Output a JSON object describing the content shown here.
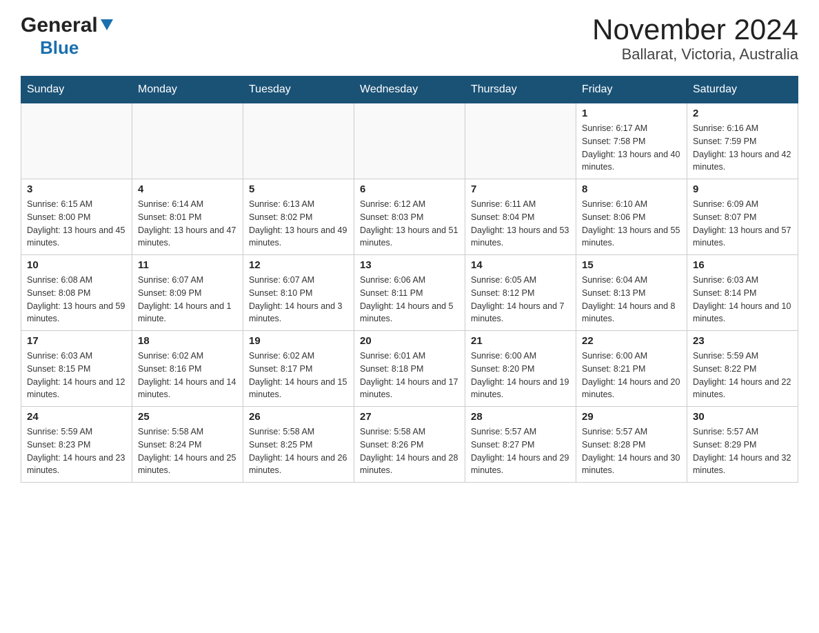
{
  "header": {
    "logo_general": "General",
    "logo_blue": "Blue",
    "title": "November 2024",
    "subtitle": "Ballarat, Victoria, Australia"
  },
  "days_of_week": [
    "Sunday",
    "Monday",
    "Tuesday",
    "Wednesday",
    "Thursday",
    "Friday",
    "Saturday"
  ],
  "weeks": [
    [
      {
        "day": "",
        "info": ""
      },
      {
        "day": "",
        "info": ""
      },
      {
        "day": "",
        "info": ""
      },
      {
        "day": "",
        "info": ""
      },
      {
        "day": "",
        "info": ""
      },
      {
        "day": "1",
        "info": "Sunrise: 6:17 AM\nSunset: 7:58 PM\nDaylight: 13 hours and 40 minutes."
      },
      {
        "day": "2",
        "info": "Sunrise: 6:16 AM\nSunset: 7:59 PM\nDaylight: 13 hours and 42 minutes."
      }
    ],
    [
      {
        "day": "3",
        "info": "Sunrise: 6:15 AM\nSunset: 8:00 PM\nDaylight: 13 hours and 45 minutes."
      },
      {
        "day": "4",
        "info": "Sunrise: 6:14 AM\nSunset: 8:01 PM\nDaylight: 13 hours and 47 minutes."
      },
      {
        "day": "5",
        "info": "Sunrise: 6:13 AM\nSunset: 8:02 PM\nDaylight: 13 hours and 49 minutes."
      },
      {
        "day": "6",
        "info": "Sunrise: 6:12 AM\nSunset: 8:03 PM\nDaylight: 13 hours and 51 minutes."
      },
      {
        "day": "7",
        "info": "Sunrise: 6:11 AM\nSunset: 8:04 PM\nDaylight: 13 hours and 53 minutes."
      },
      {
        "day": "8",
        "info": "Sunrise: 6:10 AM\nSunset: 8:06 PM\nDaylight: 13 hours and 55 minutes."
      },
      {
        "day": "9",
        "info": "Sunrise: 6:09 AM\nSunset: 8:07 PM\nDaylight: 13 hours and 57 minutes."
      }
    ],
    [
      {
        "day": "10",
        "info": "Sunrise: 6:08 AM\nSunset: 8:08 PM\nDaylight: 13 hours and 59 minutes."
      },
      {
        "day": "11",
        "info": "Sunrise: 6:07 AM\nSunset: 8:09 PM\nDaylight: 14 hours and 1 minute."
      },
      {
        "day": "12",
        "info": "Sunrise: 6:07 AM\nSunset: 8:10 PM\nDaylight: 14 hours and 3 minutes."
      },
      {
        "day": "13",
        "info": "Sunrise: 6:06 AM\nSunset: 8:11 PM\nDaylight: 14 hours and 5 minutes."
      },
      {
        "day": "14",
        "info": "Sunrise: 6:05 AM\nSunset: 8:12 PM\nDaylight: 14 hours and 7 minutes."
      },
      {
        "day": "15",
        "info": "Sunrise: 6:04 AM\nSunset: 8:13 PM\nDaylight: 14 hours and 8 minutes."
      },
      {
        "day": "16",
        "info": "Sunrise: 6:03 AM\nSunset: 8:14 PM\nDaylight: 14 hours and 10 minutes."
      }
    ],
    [
      {
        "day": "17",
        "info": "Sunrise: 6:03 AM\nSunset: 8:15 PM\nDaylight: 14 hours and 12 minutes."
      },
      {
        "day": "18",
        "info": "Sunrise: 6:02 AM\nSunset: 8:16 PM\nDaylight: 14 hours and 14 minutes."
      },
      {
        "day": "19",
        "info": "Sunrise: 6:02 AM\nSunset: 8:17 PM\nDaylight: 14 hours and 15 minutes."
      },
      {
        "day": "20",
        "info": "Sunrise: 6:01 AM\nSunset: 8:18 PM\nDaylight: 14 hours and 17 minutes."
      },
      {
        "day": "21",
        "info": "Sunrise: 6:00 AM\nSunset: 8:20 PM\nDaylight: 14 hours and 19 minutes."
      },
      {
        "day": "22",
        "info": "Sunrise: 6:00 AM\nSunset: 8:21 PM\nDaylight: 14 hours and 20 minutes."
      },
      {
        "day": "23",
        "info": "Sunrise: 5:59 AM\nSunset: 8:22 PM\nDaylight: 14 hours and 22 minutes."
      }
    ],
    [
      {
        "day": "24",
        "info": "Sunrise: 5:59 AM\nSunset: 8:23 PM\nDaylight: 14 hours and 23 minutes."
      },
      {
        "day": "25",
        "info": "Sunrise: 5:58 AM\nSunset: 8:24 PM\nDaylight: 14 hours and 25 minutes."
      },
      {
        "day": "26",
        "info": "Sunrise: 5:58 AM\nSunset: 8:25 PM\nDaylight: 14 hours and 26 minutes."
      },
      {
        "day": "27",
        "info": "Sunrise: 5:58 AM\nSunset: 8:26 PM\nDaylight: 14 hours and 28 minutes."
      },
      {
        "day": "28",
        "info": "Sunrise: 5:57 AM\nSunset: 8:27 PM\nDaylight: 14 hours and 29 minutes."
      },
      {
        "day": "29",
        "info": "Sunrise: 5:57 AM\nSunset: 8:28 PM\nDaylight: 14 hours and 30 minutes."
      },
      {
        "day": "30",
        "info": "Sunrise: 5:57 AM\nSunset: 8:29 PM\nDaylight: 14 hours and 32 minutes."
      }
    ]
  ],
  "accent_color": "#1a5276",
  "logo_color": "#1a6faf"
}
